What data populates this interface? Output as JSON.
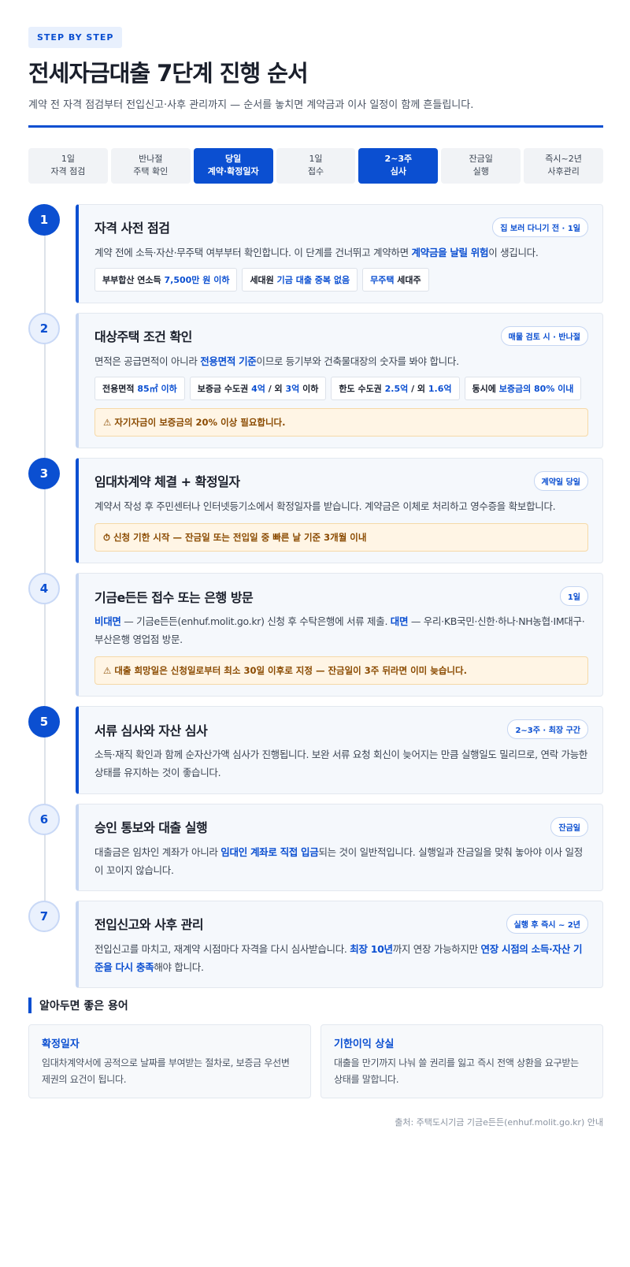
{
  "header": {
    "kicker": "STEP BY STEP",
    "title": "전세자금대출 7단계 진행 순서",
    "subtitle": "계약 전 자격 점검부터 전입신고·사후 관리까지 — 순서를 놓치면 계약금과 이사 일정이 함께 흔들립니다."
  },
  "stepbar": [
    {
      "top": "1일",
      "bottom": "자격 점검",
      "active": false
    },
    {
      "top": "반나절",
      "bottom": "주택 확인",
      "active": false
    },
    {
      "top": "당일",
      "bottom": "계약·확정일자",
      "active": true
    },
    {
      "top": "1일",
      "bottom": "접수",
      "active": false
    },
    {
      "top": "2~3주",
      "bottom": "심사",
      "active": true
    },
    {
      "top": "잔금일",
      "bottom": "실행",
      "active": false
    },
    {
      "top": "즉시~2년",
      "bottom": "사후관리",
      "active": false
    }
  ],
  "steps": [
    {
      "num": "1",
      "title": "자격 사전 점검",
      "badge": "집 보러 다니기 전 · 1일",
      "body": {
        "a": "계약 전에 소득·자산·무주택 여부부터 확인합니다. 이 단계를 건너뛰고 계약하면 ",
        "b": "계약금을 날릴 위험",
        "c": "이 생깁니다."
      },
      "tags": [
        {
          "a": "부부합산 연소득 ",
          "b": "7,500만 원 이하",
          "c": ""
        },
        {
          "a": "세대원 ",
          "b": "기금 대출 중복 없음",
          "c": ""
        },
        {
          "a": "",
          "b": "무주택",
          "c": " 세대주"
        }
      ]
    },
    {
      "num": "2",
      "title": "대상주택 조건 확인",
      "badge": "매물 검토 시 · 반나절",
      "body": {
        "a": "면적은 공급면적이 아니라 ",
        "b": "전용면적 기준",
        "c": "이므로 등기부와 건축물대장의 숫자를 봐야 합니다."
      },
      "tags": [
        {
          "a": "전용면적 ",
          "b": "85㎡ 이하",
          "c": ""
        },
        {
          "a": "보증금 수도권 ",
          "b": "4억",
          "c": " / 외 ",
          "d": "3억",
          "e": " 이하"
        },
        {
          "a": "한도 수도권 ",
          "b": "2.5억",
          "c": " / 외 ",
          "d": "1.6억",
          "e": ""
        },
        {
          "a": "동시에 ",
          "b": "보증금의 80% 이내",
          "c": ""
        }
      ],
      "warn": "⚠ 자기자금이 보증금의 20% 이상 필요합니다."
    },
    {
      "num": "3",
      "title": "임대차계약 체결 + 확정일자",
      "badge": "계약일 당일",
      "body": {
        "a": "계약서 작성 후 주민센터나 인터넷등기소에서 확정일자를 받습니다. 계약금은 이체로 처리하고 영수증을 확보합니다."
      },
      "warn": "⏱ 신청 기한 시작 — 잔금일 또는 전입일 중 빠른 날 기준 3개월 이내"
    },
    {
      "num": "4",
      "title": "기금e든든 접수 또는 은행 방문",
      "badge": "1일",
      "body": {
        "a": "비대면",
        "b": " — 기금e든든(enhuf.molit.go.kr) 신청 후 수탁은행에 서류 제출. ",
        "c": "대면",
        "d": " — 우리·KB국민·신한·하나·NH농협·IM대구·부산은행 영업점 방문."
      },
      "warn": "⚠ 대출 희망일은 신청일로부터 최소 30일 이후로 지정 — 잔금일이 3주 뒤라면 이미 늦습니다."
    },
    {
      "num": "5",
      "title": "서류 심사와 자산 심사",
      "badge": "2~3주 · 최장 구간",
      "body": {
        "a": "소득·재직 확인과 함께 순자산가액 심사가 진행됩니다. 보완 서류 요청 회신이 늦어지는 만큼 실행일도 밀리므로, 연락 가능한 상태를 유지하는 것이 좋습니다."
      }
    },
    {
      "num": "6",
      "title": "승인 통보와 대출 실행",
      "badge": "잔금일",
      "body": {
        "a": "대출금은 임차인 계좌가 아니라 ",
        "b": "임대인 계좌로 직접 입금",
        "c": "되는 것이 일반적입니다. 실행일과 잔금일을 맞춰 놓아야 이사 일정이 꼬이지 않습니다."
      }
    },
    {
      "num": "7",
      "title": "전입신고와 사후 관리",
      "badge": "실행 후 즉시 ~ 2년",
      "body": {
        "a": "전입신고를 마치고, 재계약 시점마다 자격을 다시 심사받습니다. ",
        "b": "최장 10년",
        "c": "까지 연장 가능하지만 ",
        "d": "연장 시점의 소득·자산 기준을 다시 충족",
        "e": "해야 합니다."
      }
    }
  ],
  "terms": {
    "heading": "알아두면 좋은 용어",
    "items": [
      {
        "name": "확정일자",
        "desc": "임대차계약서에 공적으로 날짜를 부여받는 절차로, 보증금 우선변제권의 요건이 됩니다."
      },
      {
        "name": "기한이익 상실",
        "desc": "대출을 만기까지 나눠 쓸 권리를 잃고 즉시 전액 상환을 요구받는 상태를 말합니다."
      }
    ]
  },
  "source": "출처: 주택도시기금 기금e든든(enhuf.molit.go.kr) 안내",
  "colors": {
    "accent": "#0b4fd1",
    "warn_bg": "#fff5e5",
    "warn_text": "#8a4a00"
  }
}
